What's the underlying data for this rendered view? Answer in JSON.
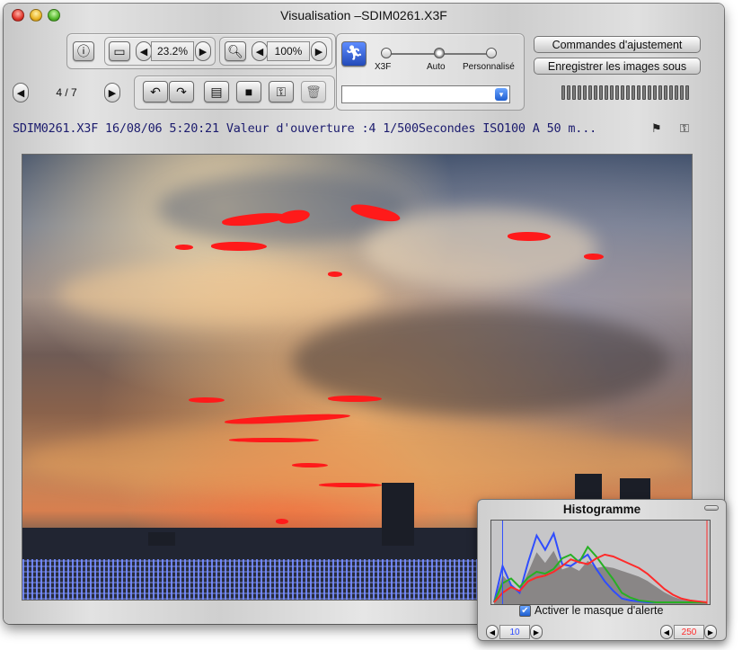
{
  "window": {
    "title": "Visualisation –SDIM0261.X3F"
  },
  "toolbar": {
    "zoom_fit_value": "23.2%",
    "zoom_value": "100%",
    "page_indicator": "4 / 7",
    "mode_labels": [
      "X3F",
      "Auto",
      "Personnalisé"
    ],
    "selected_mode": "Auto",
    "adjust_button": "Commandes d'ajustement",
    "save_button": "Enregistrer les images sous",
    "preset_select_value": ""
  },
  "info_bar": {
    "text": "SDIM0261.X3F 16/08/06 5:20:21 Valeur d'ouverture :4 1/500Secondes ISO100 A 50 m..."
  },
  "histogram": {
    "title": "Histogramme",
    "checkbox_label": "Activer le masque d'alerte",
    "checkbox_checked": true,
    "low_value": "10",
    "high_value": "250",
    "colors": {
      "blue": "#2f4dff",
      "green": "#27b024",
      "red": "#ff2a2a"
    },
    "chart_data": {
      "type": "area",
      "x": [
        0,
        10,
        20,
        30,
        40,
        50,
        60,
        70,
        80,
        90,
        100,
        110,
        120,
        130,
        140,
        150,
        160,
        170,
        180,
        190,
        200,
        210,
        220,
        230,
        240,
        250
      ],
      "series": [
        {
          "values": [
            0,
            38,
            18,
            10,
            42,
            70,
            55,
            72,
            40,
            38,
            44,
            50,
            35,
            22,
            12,
            4,
            2,
            1,
            0,
            0,
            0,
            0,
            0,
            0,
            0,
            0
          ]
        },
        {
          "values": [
            0,
            20,
            25,
            16,
            26,
            32,
            30,
            35,
            46,
            50,
            42,
            58,
            48,
            36,
            24,
            10,
            5,
            2,
            1,
            0,
            0,
            0,
            0,
            0,
            0,
            0
          ]
        },
        {
          "values": [
            0,
            10,
            16,
            12,
            22,
            26,
            28,
            32,
            38,
            45,
            42,
            40,
            46,
            50,
            48,
            44,
            40,
            36,
            30,
            22,
            14,
            8,
            4,
            2,
            1,
            0
          ]
        }
      ]
    }
  }
}
